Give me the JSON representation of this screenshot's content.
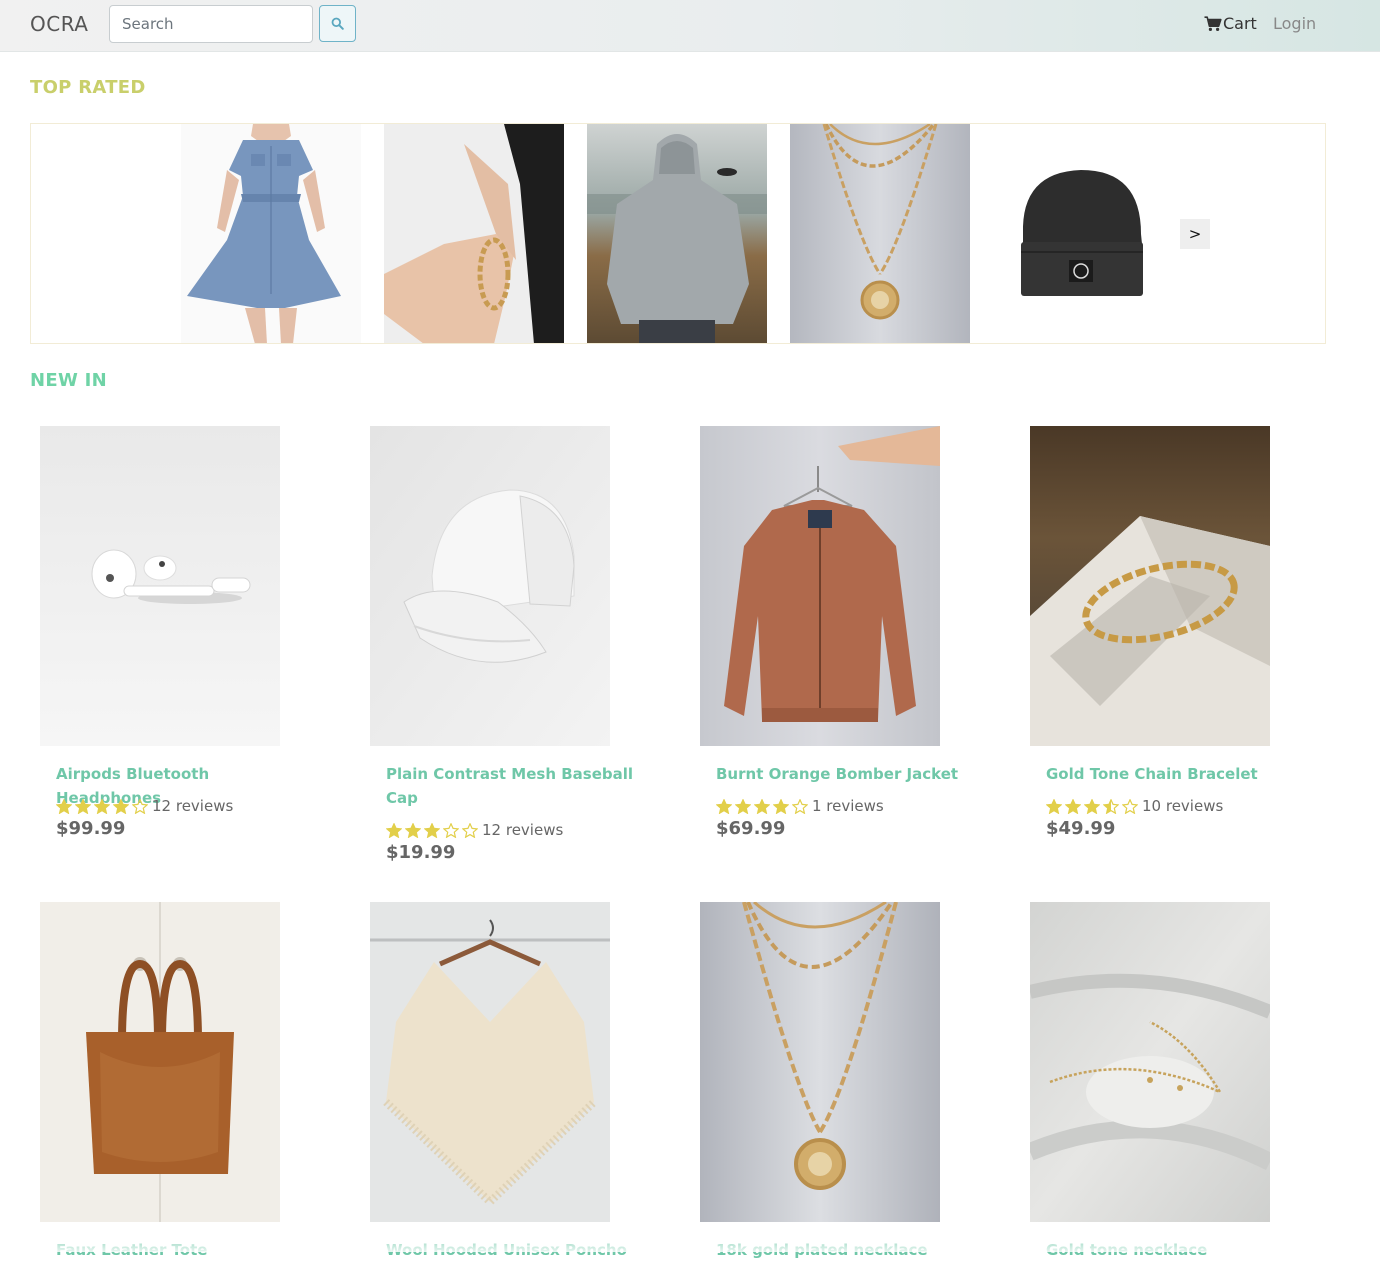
{
  "navbar": {
    "brand": "OCRA",
    "search_placeholder": "Search",
    "search_value": "",
    "cart_label": "Cart",
    "login_label": "Login"
  },
  "top_rated": {
    "title": "TOP RATED",
    "slides": [
      {
        "image": "denim-dress-photo"
      },
      {
        "image": "gold-bracelet-wrist-photo"
      },
      {
        "image": "grey-hoodie-photo"
      },
      {
        "image": "gold-necklace-photo"
      },
      {
        "image": "black-beanie-photo"
      }
    ],
    "next_label": ">"
  },
  "new_in": {
    "title": "NEW IN",
    "products": [
      {
        "name": "Airpods Bluetooth Headphones",
        "rating": 4,
        "reviews": "12 reviews",
        "price": "$99.99",
        "image": "airpods-photo"
      },
      {
        "name": "Plain Contrast Mesh Baseball Cap",
        "rating": 3,
        "reviews": "12 reviews",
        "price": "$19.99",
        "image": "white-cap-photo"
      },
      {
        "name": "Burnt Orange Bomber Jacket",
        "rating": 4,
        "reviews": "1 reviews",
        "price": "$69.99",
        "image": "bomber-jacket-photo"
      },
      {
        "name": "Gold Tone Chain Bracelet",
        "rating": 3.5,
        "reviews": "10 reviews",
        "price": "$49.99",
        "image": "chain-bracelet-photo"
      },
      {
        "name": "Faux Leather Tote",
        "image": "leather-tote-photo"
      },
      {
        "name": "Wool Hooded Unisex Poncho",
        "image": "poncho-photo"
      },
      {
        "name": "18k gold plated necklace",
        "image": "gold-plated-necklace-photo"
      },
      {
        "name": "Gold tone necklace",
        "image": "gold-tone-necklace-photo"
      }
    ]
  },
  "colors": {
    "top_rated_title": "#c9cf6b",
    "new_in_title": "#6fd3a6",
    "product_name": "#6fc7a8",
    "star": "#e2cf4a"
  }
}
